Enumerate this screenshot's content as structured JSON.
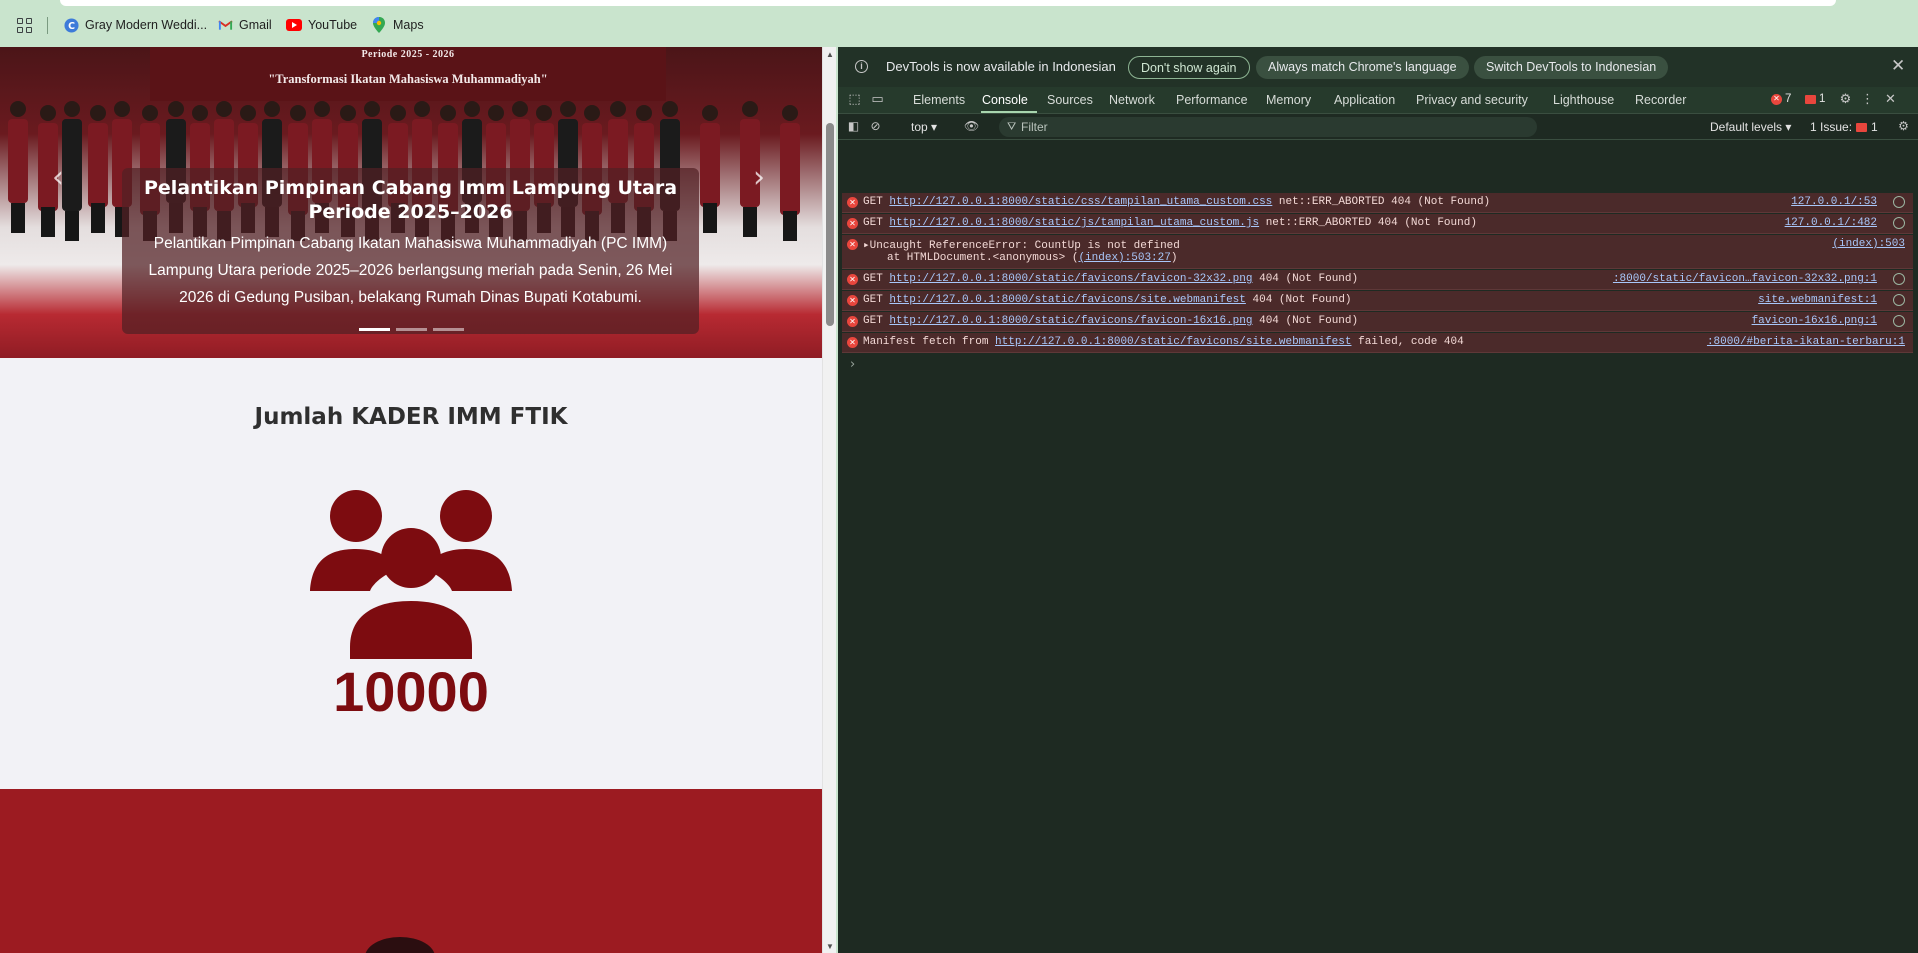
{
  "bookmarks": [
    {
      "label": "Gray Modern Weddi...",
      "icon": "canva-icon"
    },
    {
      "label": "Gmail",
      "icon": "gmail-icon"
    },
    {
      "label": "YouTube",
      "icon": "youtube-icon"
    },
    {
      "label": "Maps",
      "icon": "maps-icon"
    }
  ],
  "page": {
    "hero": {
      "banner_period": "Periode 2025 - 2026",
      "banner_quote": "\"Transformasi Ikatan Mahasiswa Muhammadiyah\"",
      "caption_title": "Pelantikan Pimpinan Cabang Imm Lampung Utara Periode 2025–2026",
      "caption_text": "Pelantikan Pimpinan Cabang Ikatan Mahasiswa Muhammadiyah (PC IMM) Lampung Utara periode 2025–2026 berlangsung meriah pada Senin, 26 Mei 2026 di Gedung Pusiban, belakang Rumah Dinas Bupati Kotabumi.",
      "slide_count": 3,
      "active_slide": 1
    },
    "stats": {
      "title": "Jumlah KADER IMM FTIK",
      "icon": "users-icon",
      "count": "10000"
    }
  },
  "devtools": {
    "infobar": {
      "message": "DevTools is now available in Indonesian",
      "dont_show": "Don't show again",
      "match_language": "Always match Chrome's language",
      "switch_language": "Switch DevTools to Indonesian"
    },
    "tabs": [
      "Elements",
      "Console",
      "Sources",
      "Network",
      "Performance",
      "Memory",
      "Application",
      "Privacy and security",
      "Lighthouse",
      "Recorder"
    ],
    "active_tab": "Console",
    "error_count": "7",
    "issue_flag_count": "1",
    "filter": {
      "context": "top",
      "placeholder": "Filter",
      "levels": "Default levels",
      "issues_label": "1 Issue:",
      "issues_count": "1"
    },
    "console_rows": [
      {
        "method": "GET",
        "url": "http://127.0.0.1:8000/static/css/tampilan_utama_custom.css",
        "msg": "net::ERR_ABORTED 404 (Not Found)",
        "source": "127.0.0.1/:53"
      },
      {
        "method": "GET",
        "url": "http://127.0.0.1:8000/static/js/tampilan_utama_custom.js",
        "msg": "net::ERR_ABORTED 404 (Not Found)",
        "source": "127.0.0.1/:482"
      },
      {
        "line1": "Uncaught ReferenceError: CountUp is not defined",
        "line2_prefix": "at HTMLDocument.<anonymous> (",
        "line2_link": "(index):503:27",
        "line2_suffix": ")",
        "source": "(index):503"
      },
      {
        "method": "GET",
        "url": "http://127.0.0.1:8000/static/favicons/favicon-32x32.png",
        "msg": "404 (Not Found)",
        "source": ":8000/static/favicon…favicon-32x32.png:1"
      },
      {
        "method": "GET",
        "url": "http://127.0.0.1:8000/static/favicons/site.webmanifest",
        "msg": "404 (Not Found)",
        "source": "site.webmanifest:1"
      },
      {
        "method": "GET",
        "url": "http://127.0.0.1:8000/static/favicons/favicon-16x16.png",
        "msg": "404 (Not Found)",
        "source": "favicon-16x16.png:1"
      },
      {
        "prefix": "Manifest fetch from",
        "url": "http://127.0.0.1:8000/static/favicons/site.webmanifest",
        "msg": "failed, code 404",
        "source": ":8000/#berita-ikatan-terbaru:1"
      }
    ]
  },
  "colors": {
    "brand_maroon": "#7d0c10",
    "section_red": "#9c1b21",
    "devtools_bg": "#1e2a22",
    "error_row": "#4b2a2a",
    "chrome_frame": "#c9e4cd"
  }
}
